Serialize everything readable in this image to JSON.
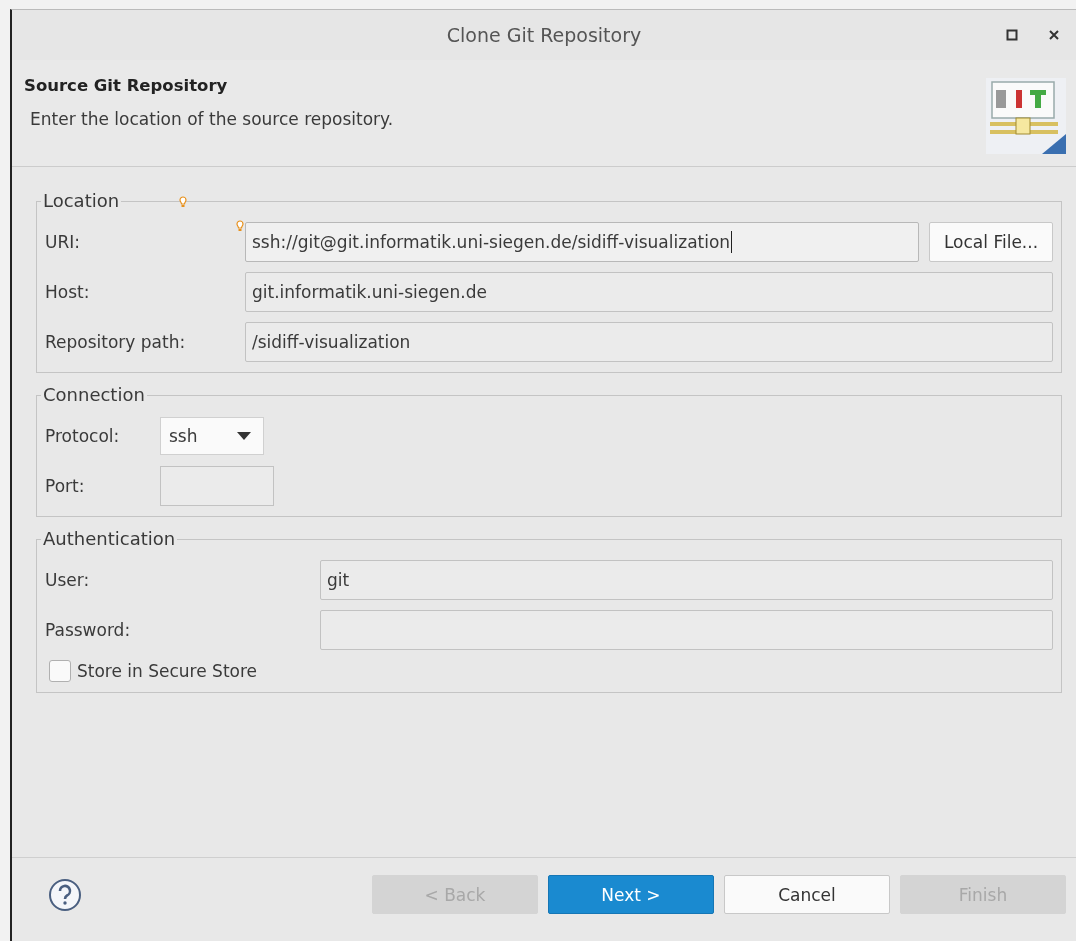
{
  "window": {
    "title": "Clone Git Repository"
  },
  "header": {
    "title": "Source Git Repository",
    "description": "Enter the location of the source repository."
  },
  "groups": [
    {
      "title": "Location",
      "decorated": true,
      "fields": [
        {
          "kind": "text",
          "label": "URI:",
          "value": "ssh://git@git.informatik.uni-siegen.de/sidiff-visualization",
          "focused": true,
          "decorated": true,
          "button": "Local File..."
        },
        {
          "kind": "text",
          "label": "Host:",
          "value": "git.informatik.uni-siegen.de",
          "focused": false,
          "decorated": false
        },
        {
          "kind": "text",
          "label": "Repository path:",
          "value": "/sidiff-visualization",
          "focused": false,
          "decorated": false
        }
      ]
    },
    {
      "title": "Connection",
      "decorated": false,
      "fields": [
        {
          "kind": "combo",
          "label": "Protocol:",
          "value": "ssh"
        },
        {
          "kind": "short",
          "label": "Port:"
        }
      ]
    },
    {
      "title": "Authentication",
      "decorated": false,
      "fields": [
        {
          "kind": "text",
          "label": "User:",
          "value": "git",
          "focused": false,
          "decorated": false
        },
        {
          "kind": "text",
          "label": "Password:",
          "focused": false,
          "decorated": false
        },
        {
          "kind": "checkbox",
          "label": "Store in Secure Store",
          "checked": false
        }
      ]
    }
  ],
  "buttons": [
    {
      "label": "< Back",
      "kind": "normal",
      "disabled": true
    },
    {
      "label": "Next >",
      "kind": "default",
      "disabled": false
    },
    {
      "label": "Cancel",
      "kind": "normal",
      "disabled": false
    },
    {
      "label": "Finish",
      "kind": "normal",
      "disabled": true
    }
  ]
}
